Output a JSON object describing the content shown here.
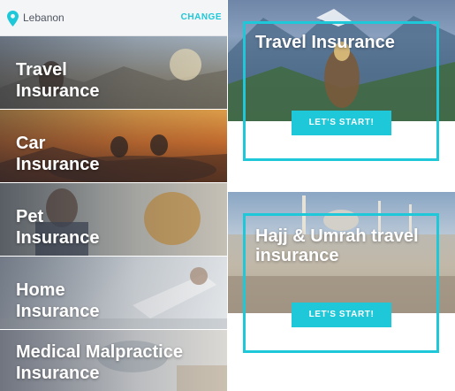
{
  "location": {
    "value": "Lebanon",
    "change_label": "CHANGE",
    "icon": "map-pin-icon",
    "accent_color": "#1ec8d8"
  },
  "categories": [
    {
      "line1": "Travel",
      "line2": "Insurance"
    },
    {
      "line1": "Car",
      "line2": "Insurance"
    },
    {
      "line1": "Pet",
      "line2": "Insurance"
    },
    {
      "line1": "Home",
      "line2": "Insurance"
    },
    {
      "line1": "Medical Malpractice",
      "line2": "Insurance"
    }
  ],
  "cards": [
    {
      "title": "Travel Insurance",
      "cta": "LET'S START!"
    },
    {
      "title": "Hajj & Umrah travel insurance",
      "cta": "LET'S START!"
    }
  ]
}
